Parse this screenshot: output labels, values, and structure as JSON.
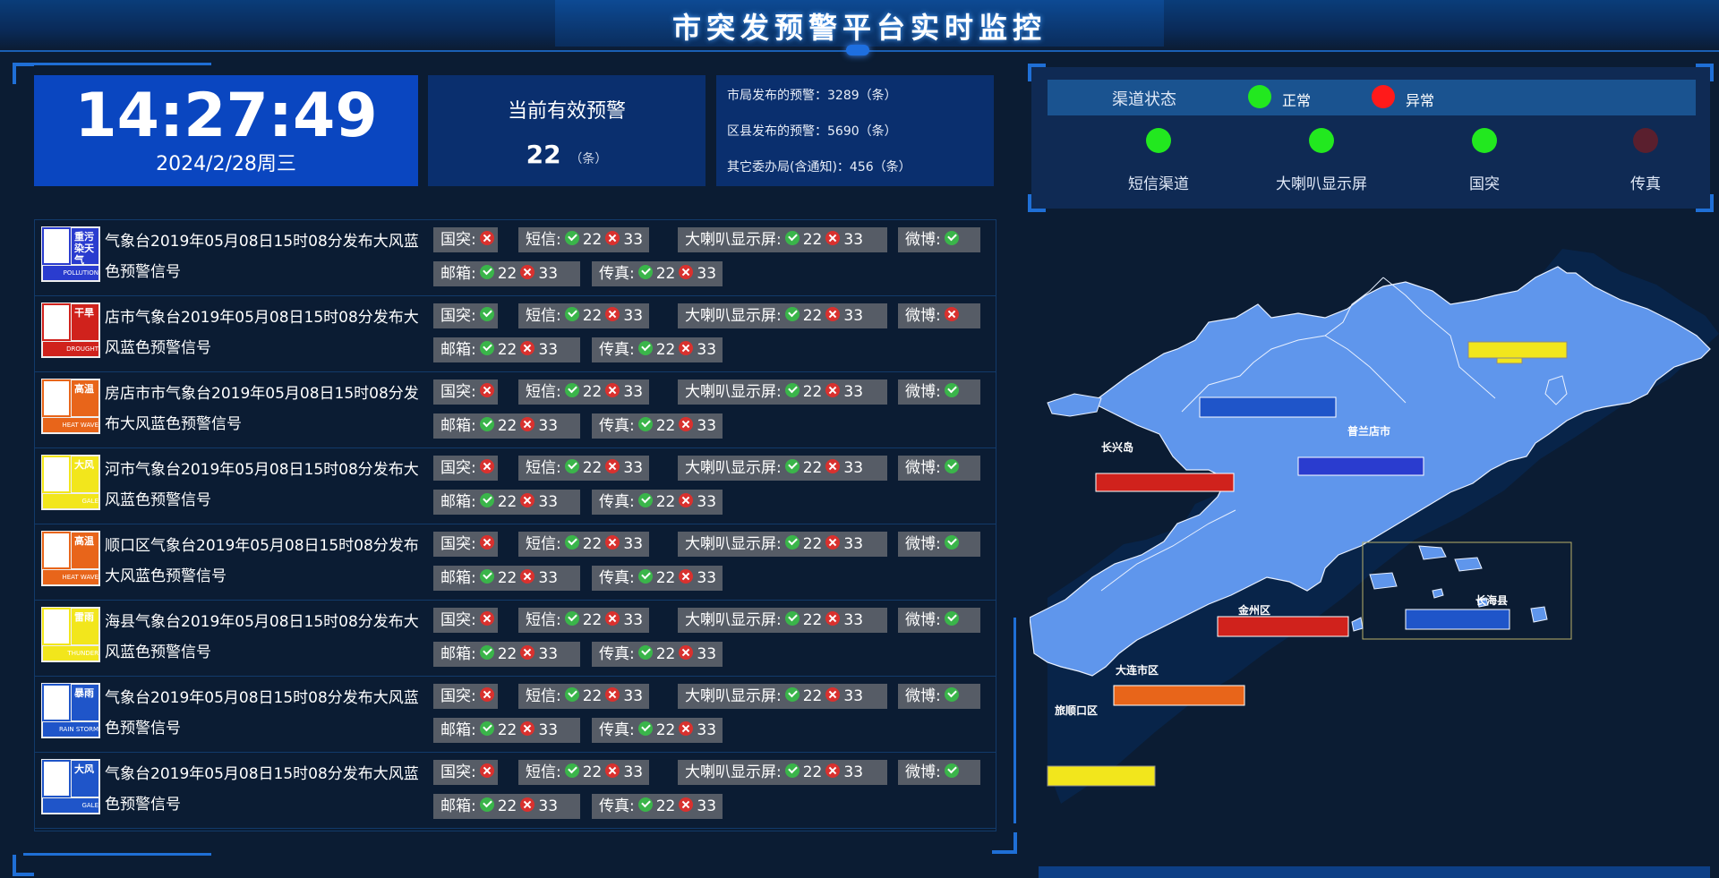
{
  "header": {
    "title": "市突发预警平台实时监控"
  },
  "clock": {
    "time": "14:27:49",
    "date": "2024/2/28周三"
  },
  "active_alerts": {
    "label": "当前有效预警",
    "count": "22",
    "unit": "（条）"
  },
  "stats": [
    "市局发布的预警：3289（条）",
    "区县发布的预警：5690（条）",
    "其它委办局(含通知)：456（条）"
  ],
  "channel_status": {
    "title": "渠道状态",
    "legend_normal": "正常",
    "legend_abnormal": "异常",
    "colors": {
      "normal": "#22e81f",
      "abnormal": "#ff1a1a",
      "off": "#5a1f2e"
    },
    "channels": [
      {
        "label": "短信渠道",
        "state": "normal"
      },
      {
        "label": "大喇叭显示屏",
        "state": "normal"
      },
      {
        "label": "国突",
        "state": "normal"
      },
      {
        "label": "传真",
        "state": "off"
      }
    ]
  },
  "labels": {
    "guotu": "国突:",
    "sms": "短信:",
    "speaker": "大喇叭显示屏:",
    "weibo": "微博:",
    "email": "邮箱:",
    "fax": "传真:",
    "ok_count": "22",
    "fail_count": "33"
  },
  "alerts": [
    {
      "text": "气象台2019年05月08日15时08分发布大风蓝色预警信号",
      "icon": "pollution",
      "icon_top": "重污染天气",
      "icon_bottom": "POLLUTION",
      "icon_color": "#2a3ccf",
      "guotu": "fail",
      "weibo": "ok"
    },
    {
      "text": "店市气象台2019年05月08日15时08分发布大风蓝色预警信号",
      "icon": "drought",
      "icon_top": "干旱",
      "icon_bottom": "DROUGHT",
      "icon_color": "#d0221c",
      "guotu": "ok",
      "weibo": "fail"
    },
    {
      "text": "房店市市气象台2019年05月08日15时08分发布大风蓝色预警信号",
      "icon": "heat",
      "icon_top": "高温",
      "icon_bottom": "HEAT WAVE",
      "icon_color": "#e8651a",
      "guotu": "fail",
      "weibo": "ok"
    },
    {
      "text": "河市气象台2019年05月08日15时08分发布大风蓝色预警信号",
      "icon": "gale-yellow",
      "icon_top": "大风",
      "icon_bottom": "GALE",
      "icon_color": "#f2e61c",
      "guotu": "fail",
      "weibo": "ok"
    },
    {
      "text": "顺口区气象台2019年05月08日15时08分发布大风蓝色预警信号",
      "icon": "heat",
      "icon_top": "高温",
      "icon_bottom": "HEAT WAVE",
      "icon_color": "#e8651a",
      "guotu": "fail",
      "weibo": "ok"
    },
    {
      "text": "海县气象台2019年05月08日15时08分发布大风蓝色预警信号",
      "icon": "thunder",
      "icon_top": "雷雨",
      "icon_bottom": "THUNDER",
      "icon_color": "#f2e61c",
      "guotu": "fail",
      "weibo": "ok"
    },
    {
      "text": "气象台2019年05月08日15时08分发布大风蓝色预警信号",
      "icon": "rainstorm",
      "icon_top": "暴雨",
      "icon_bottom": "RAIN STORM",
      "icon_color": "#1f55c9",
      "guotu": "fail",
      "weibo": "ok"
    },
    {
      "text": "气象台2019年05月08日15时08分发布大风蓝色预警信号",
      "icon": "gale-blue",
      "icon_top": "大风",
      "icon_bottom": "GALE",
      "icon_color": "#1f55c9",
      "guotu": "fail",
      "weibo": "ok"
    }
  ],
  "map": {
    "region_labels": [
      "长兴岛",
      "普兰店市",
      "金州区",
      "长海县",
      "大连市区",
      "旅顺口区"
    ]
  }
}
